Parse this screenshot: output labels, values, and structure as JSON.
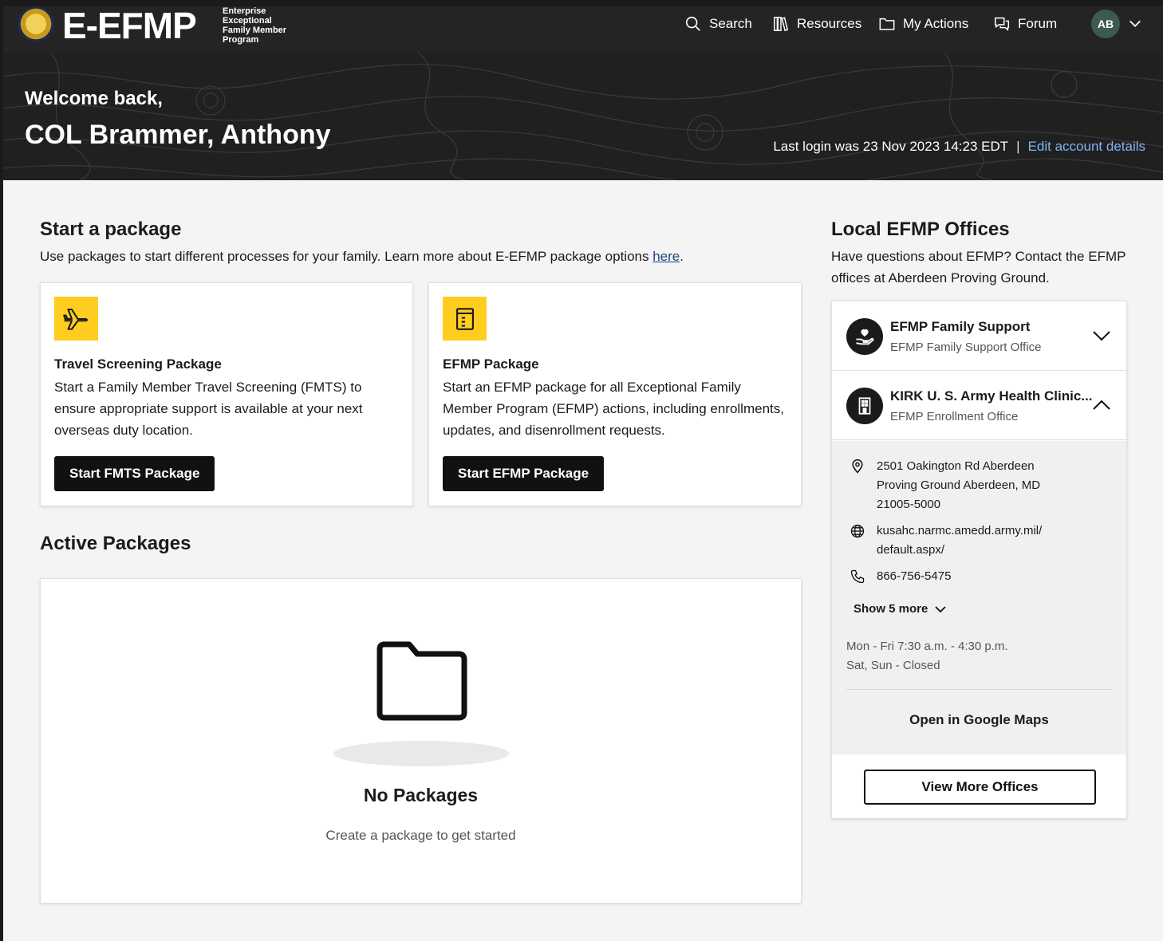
{
  "nav": {
    "brand": "E-EFMP",
    "brand_sub": [
      "Enterprise",
      "Exceptional",
      "Family Member",
      "Program"
    ],
    "search": "Search",
    "resources": "Resources",
    "my_actions": "My Actions",
    "forum": "Forum",
    "avatar_initials": "AB"
  },
  "hero": {
    "welcome": "Welcome back,",
    "name": "COL Brammer, Anthony",
    "last_login": "Last login was 23 Nov 2023 14:23 EDT",
    "separator": "|",
    "edit_link": "Edit account details"
  },
  "start": {
    "title": "Start a package",
    "intro_prefix": "Use packages to start different processes for your family. Learn more about E-EFMP package options ",
    "intro_link": "here",
    "intro_suffix": ".",
    "packages": [
      {
        "icon": "airplane-icon",
        "title": "Travel Screening Package",
        "description": "Start a Family Member Travel Screening (FMTS) to ensure appropriate support is available at your next overseas duty location.",
        "button": "Start FMTS Package"
      },
      {
        "icon": "clipboard-icon",
        "title": "EFMP Package",
        "description": "Start an EFMP package for all Exceptional Family Member Program (EFMP) actions, including enrollments, updates, and disenrollment requests.",
        "button": "Start EFMP Package"
      }
    ]
  },
  "active": {
    "title": "Active Packages",
    "empty_title": "No Packages",
    "empty_sub": "Create a package to get started"
  },
  "offices": {
    "title": "Local EFMP Offices",
    "intro": "Have questions about EFMP? Contact the EFMP offices at Aberdeen Proving Ground.",
    "items": [
      {
        "name": "EFMP Family Support",
        "type": "EFMP Family Support Office",
        "expanded": false
      },
      {
        "name": "KIRK U. S. Army Health Clinic...",
        "type": "EFMP Enrollment Office",
        "expanded": true
      }
    ],
    "detail": {
      "address": "2501 Oakington Rd Aberdeen Proving Ground Aberdeen, MD 21005-5000",
      "website": "kusahc.narmc.amedd.army.mil/ default.aspx/",
      "phone": "866-756-5475",
      "show_more": "Show 5 more",
      "hours_weekday": "Mon - Fri 7:30 a.m. - 4:30 p.m.",
      "hours_weekend": "Sat, Sun - Closed",
      "maps_link": "Open in Google Maps"
    },
    "view_more": "View More Offices"
  },
  "colors": {
    "nav_bg": "#242424",
    "accent_yellow": "#ffcd1f",
    "link_blue": "#1a4480",
    "hero_link": "#7fb4f0"
  }
}
